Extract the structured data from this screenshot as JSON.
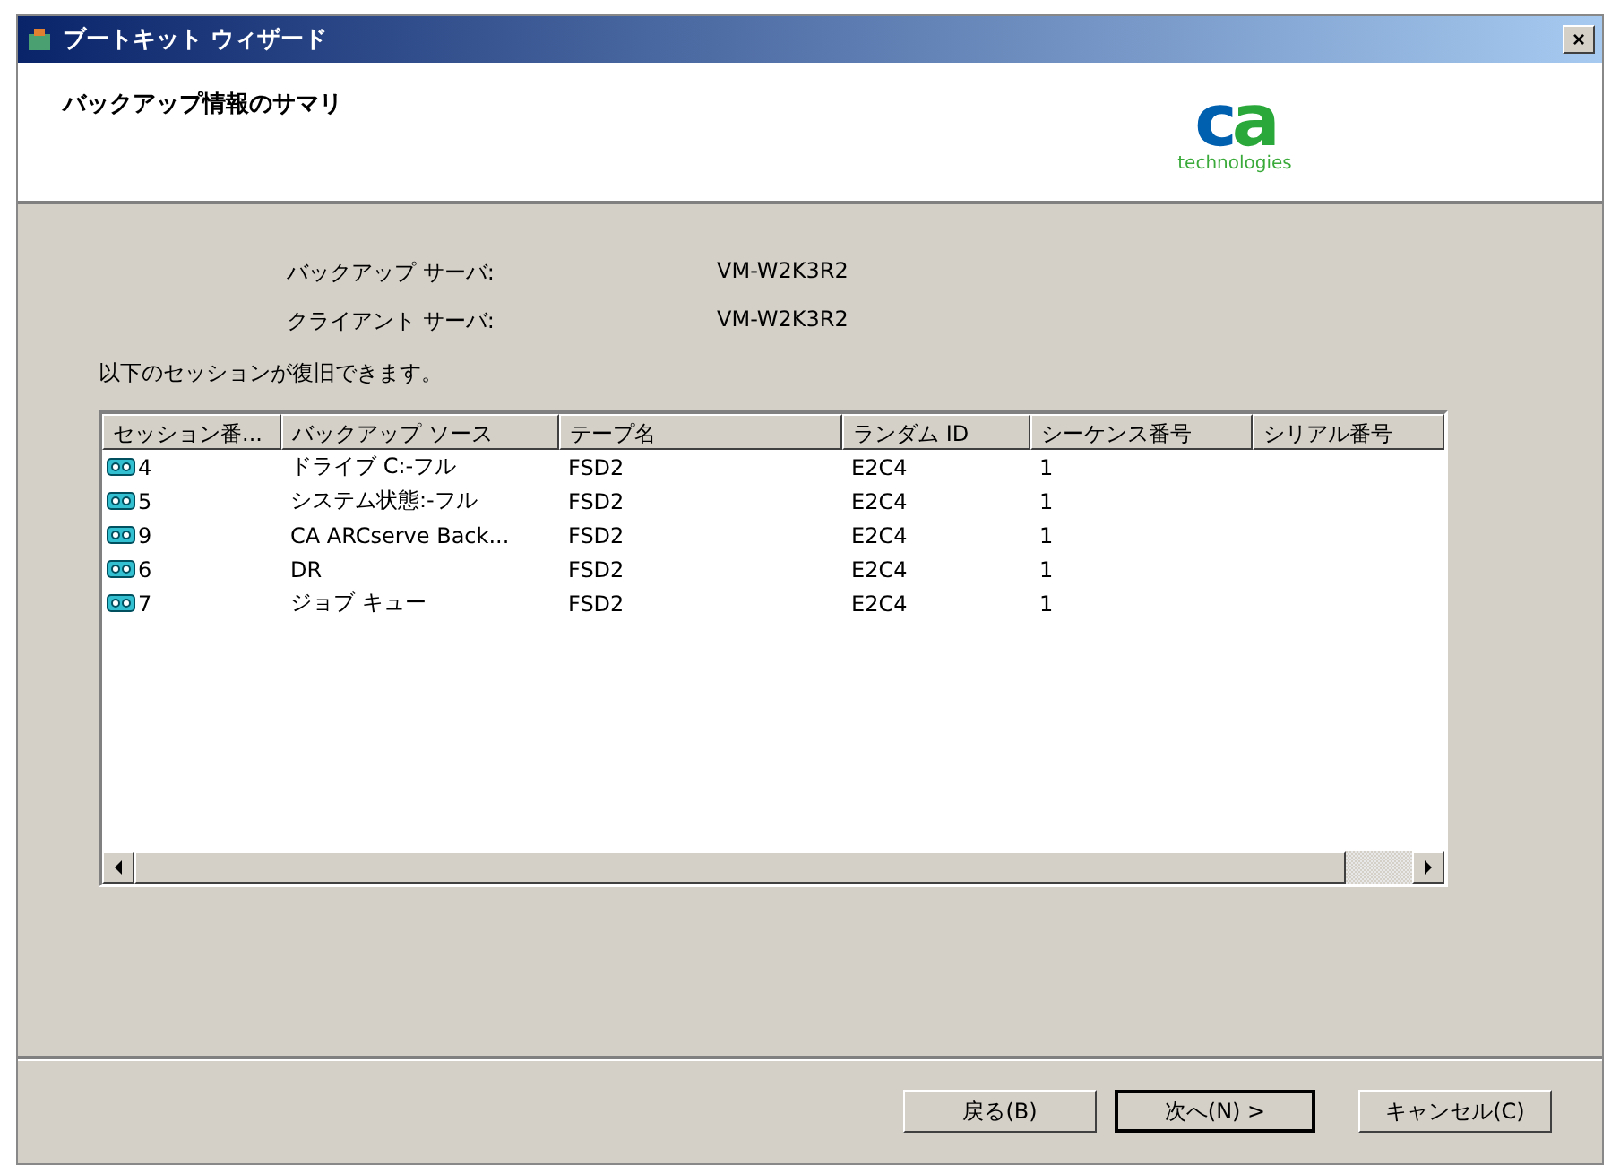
{
  "window": {
    "title": "ブートキット ウィザード",
    "close": "×"
  },
  "header": {
    "title": "バックアップ情報のサマリ",
    "logo": {
      "mark": "ca",
      "tagline": "technologies"
    }
  },
  "info": [
    {
      "label": "バックアップ サーバ:",
      "value": "VM-W2K3R2"
    },
    {
      "label": "クライアント サーバ:",
      "value": "VM-W2K3R2"
    }
  ],
  "intro": "以下のセッションが復旧できます。",
  "table": {
    "columns": [
      "セッション番...",
      "バックアップ ソース",
      "テープ名",
      "ランダム ID",
      "シーケンス番号",
      "シリアル番号"
    ],
    "rows": [
      [
        "4",
        "ドライブ C:-フル",
        "FSD2",
        "E2C4",
        "1"
      ],
      [
        "5",
        "システム状態:-フル",
        "FSD2",
        "E2C4",
        "1"
      ],
      [
        "9",
        "CA ARCserve Back...",
        "FSD2",
        "E2C4",
        "1"
      ],
      [
        "6",
        "DR",
        "FSD2",
        "E2C4",
        "1"
      ],
      [
        "7",
        "ジョブ キュー",
        "FSD2",
        "E2C4",
        "1"
      ]
    ]
  },
  "buttons": [
    {
      "label": "戻る(B)",
      "default": false
    },
    {
      "label": "次へ(N) >",
      "default": true
    },
    {
      "label": "キャンセル(C)",
      "default": false
    }
  ]
}
